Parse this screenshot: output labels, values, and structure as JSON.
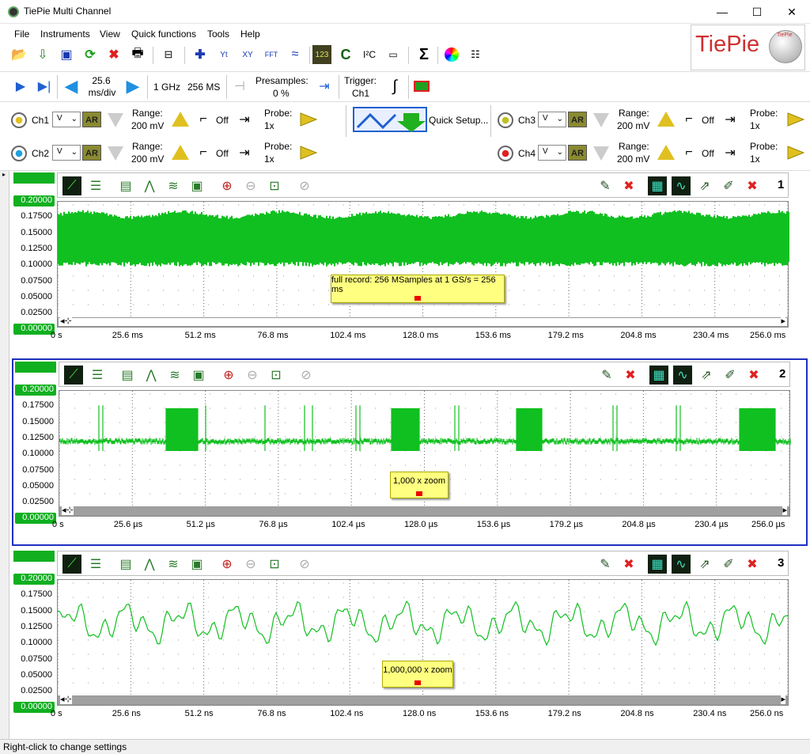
{
  "window": {
    "title": "TiePie Multi Channel",
    "minimize": "—",
    "maximize": "☐",
    "close": "✕"
  },
  "menu": [
    "File",
    "Instruments",
    "View",
    "Quick functions",
    "Tools",
    "Help"
  ],
  "logo": {
    "text": "TiePie",
    "sub": "TiePie"
  },
  "acquisition": {
    "timebase_value": "25.6",
    "timebase_unit": "ms/div",
    "sample_rate": "1 GHz",
    "record_length": "256 MS",
    "presamples_label": "Presamples:",
    "presamples_value": "0 %",
    "trigger_label": "Trigger:",
    "trigger_source": "Ch1"
  },
  "channels": [
    {
      "name": "Ch1",
      "unit": "V",
      "ar": "AR",
      "range_label": "Range:",
      "range_value": "200 mV",
      "filter": "Off",
      "probe_label": "Probe:",
      "probe_value": "1x",
      "color": "#e0c020"
    },
    {
      "name": "Ch2",
      "unit": "V",
      "ar": "AR",
      "range_label": "Range:",
      "range_value": "200 mV",
      "filter": "Off",
      "probe_label": "Probe:",
      "probe_value": "1x",
      "color": "#20a0e0"
    },
    {
      "name": "Ch3",
      "unit": "V",
      "ar": "AR",
      "range_label": "Range:",
      "range_value": "200 mV",
      "filter": "Off",
      "probe_label": "Probe:",
      "probe_value": "1x",
      "color": "#c0c020"
    },
    {
      "name": "Ch4",
      "unit": "V",
      "ar": "AR",
      "range_label": "Range:",
      "range_value": "200 mV",
      "filter": "Off",
      "probe_label": "Probe:",
      "probe_value": "1x",
      "color": "#e02020"
    }
  ],
  "quick_setup": "Quick Setup...",
  "y_labels": [
    "0.20000",
    "0.17500",
    "0.15000",
    "0.12500",
    "0.10000",
    "0.07500",
    "0.05000",
    "0.02500",
    "0.00000"
  ],
  "panels": [
    {
      "number": "1",
      "note": "full record: 256 MSamples at 1 GS/s = 256 ms",
      "x_labels": [
        "0 s",
        "25.6 ms",
        "51.2 ms",
        "76.8 ms",
        "102.4 ms",
        "128.0 ms",
        "153.6 ms",
        "179.2 ms",
        "204.8 ms",
        "230.4 ms",
        "256.0 ms"
      ]
    },
    {
      "number": "2",
      "note": "1,000 x zoom",
      "x_labels": [
        "0 s",
        "25.6 µs",
        "51.2 µs",
        "76.8 µs",
        "102.4 µs",
        "128.0 µs",
        "153.6 µs",
        "179.2 µs",
        "204.8 µs",
        "230.4 µs",
        "256.0 µs"
      ]
    },
    {
      "number": "3",
      "note": "1,000,000 x zoom",
      "x_labels": [
        "0 s",
        "25.6 ns",
        "51.2 ns",
        "76.8 ns",
        "102.4 ns",
        "128.0 ns",
        "153.6 ns",
        "179.2 ns",
        "204.8 ns",
        "230.4 ns",
        "256.0 ns"
      ]
    }
  ],
  "status": "Right-click to change settings",
  "colors": {
    "signal": "#10c020",
    "accent": "#2030c0"
  }
}
